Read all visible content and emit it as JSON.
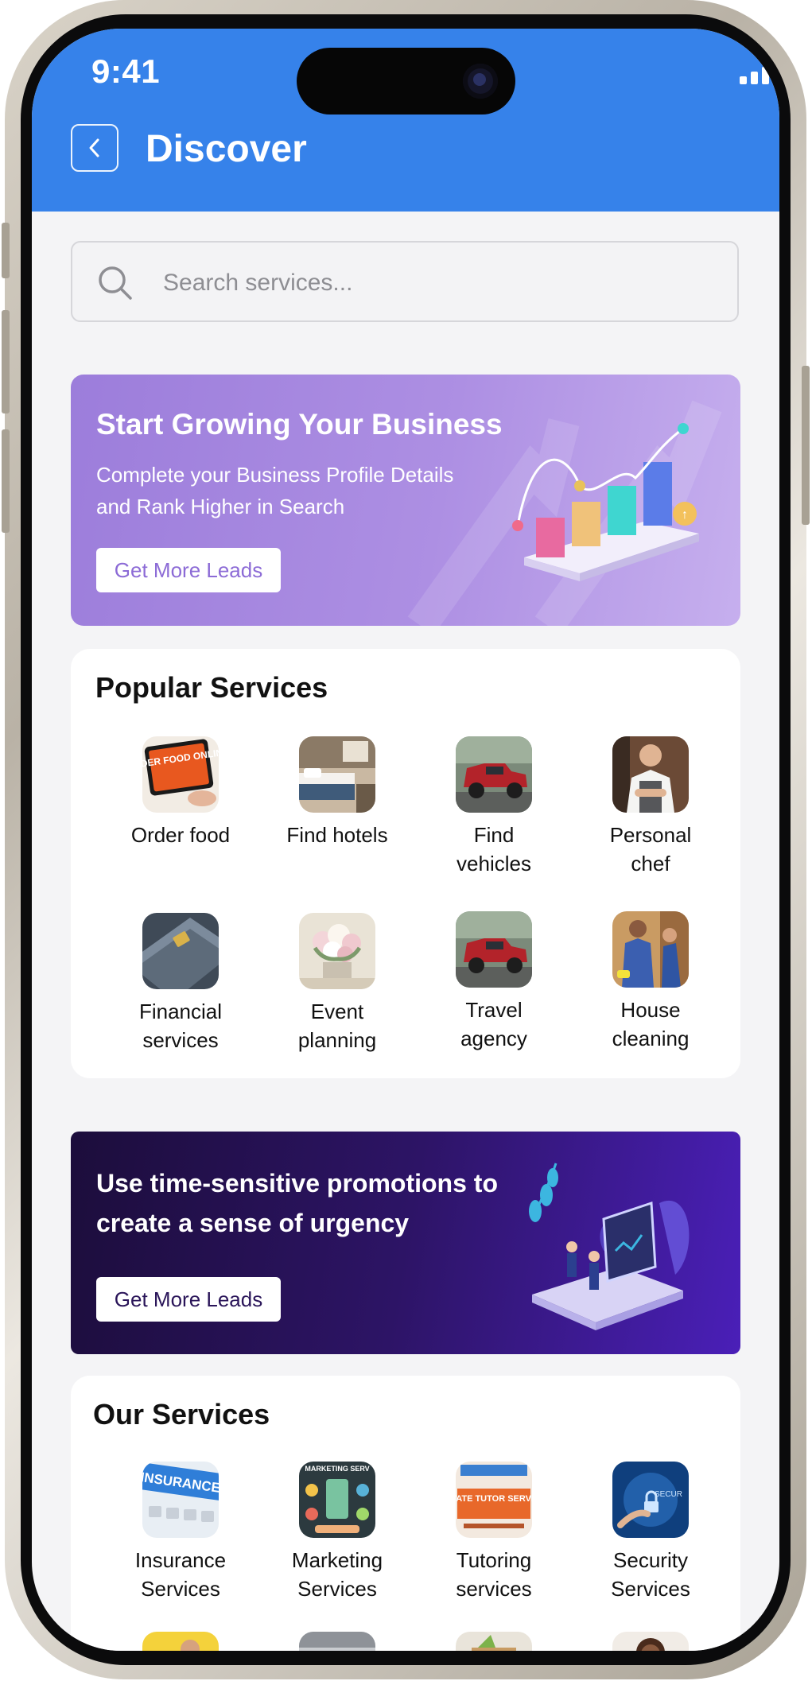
{
  "status_bar": {
    "time": "9:41"
  },
  "header": {
    "title": "Discover"
  },
  "search": {
    "placeholder": "Search services..."
  },
  "banner_growth": {
    "title": "Start Growing Your Business",
    "subtitle": "Complete your Business Profile Details and Rank Higher in Search",
    "button_label": "Get More Leads"
  },
  "popular_services": {
    "title": "Popular Services",
    "items": [
      {
        "label": "Order food",
        "icon": "order-food-photo"
      },
      {
        "label": "Find hotels",
        "icon": "hotel-room-photo"
      },
      {
        "label": "Find vehicles",
        "icon": "red-truck-photo"
      },
      {
        "label": "Personal chef",
        "icon": "chef-photo"
      },
      {
        "label": "Financial services",
        "icon": "credit-card-photo"
      },
      {
        "label": "Event planning",
        "icon": "flower-arrangement-photo"
      },
      {
        "label": "Travel agency",
        "icon": "red-truck-photo"
      },
      {
        "label": "House cleaning",
        "icon": "cleaner-photo"
      }
    ],
    "thumb_text": {
      "order_food": "ORDER FOOD ONLINE"
    }
  },
  "banner_promo": {
    "title": "Use time-sensitive promotions to create a sense of urgency",
    "button_label": "Get More Leads"
  },
  "our_services": {
    "title": "Our Services",
    "items": [
      {
        "label": "Insurance Services",
        "icon": "insurance-photo"
      },
      {
        "label": "Marketing Services",
        "icon": "marketing-photo"
      },
      {
        "label": "Tutoring services",
        "icon": "tutor-flyer-photo"
      },
      {
        "label": "Security Services",
        "icon": "security-lock-photo"
      }
    ],
    "thumb_text": {
      "insurance": "INSURANCE",
      "marketing": "MARKETING SERV",
      "tutoring": "PRIVATE TUTOR SERVICES",
      "security": "SECUR"
    }
  },
  "colors": {
    "header": "#3682ea",
    "banner_growth": "#a98be0",
    "banner_promo": "#2d1466",
    "background": "#f4f4f6"
  }
}
